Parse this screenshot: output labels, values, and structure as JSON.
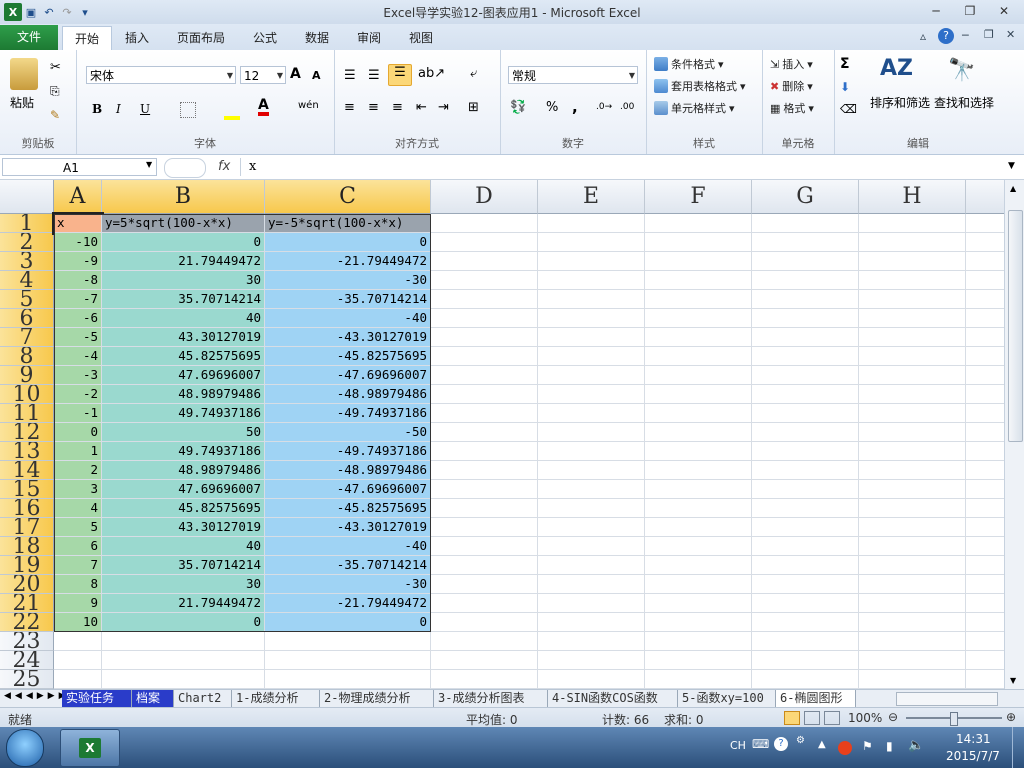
{
  "window": {
    "title": "Excel导学实验12-图表应用1 - Microsoft Excel",
    "minimize": "─",
    "restore": "❐",
    "close": "✕"
  },
  "ribbon_tabs": [
    {
      "label": "文件"
    },
    {
      "label": "开始"
    },
    {
      "label": "插入"
    },
    {
      "label": "页面布局"
    },
    {
      "label": "公式"
    },
    {
      "label": "数据"
    },
    {
      "label": "审阅"
    },
    {
      "label": "视图"
    }
  ],
  "ribbon": {
    "clipboard": {
      "label": "剪贴板",
      "paste": "粘贴"
    },
    "font": {
      "label": "字体",
      "name": "宋体",
      "size": "12",
      "bold": "B",
      "italic": "I",
      "underline": "U",
      "grow": "A",
      "shrink": "A",
      "wen": "wén"
    },
    "align": {
      "label": "对齐方式"
    },
    "number": {
      "label": "数字",
      "format": "常规",
      "percent": "%",
      "comma": ","
    },
    "styles": {
      "label": "样式",
      "cond": "条件格式",
      "table": "套用表格格式",
      "cell": "单元格样式"
    },
    "cells": {
      "label": "单元格",
      "insert": "插入",
      "delete": "删除",
      "format": "格式"
    },
    "editing": {
      "label": "编辑",
      "sum": "Σ",
      "sort": "排序和筛选",
      "find": "查找和选择"
    }
  },
  "formula_bar": {
    "name_box": "A1",
    "fx": "fx",
    "content": "x"
  },
  "columns": [
    "A",
    "B",
    "C",
    "D",
    "E",
    "F",
    "G",
    "H"
  ],
  "row_numbers": [
    "1",
    "2",
    "3",
    "4",
    "5",
    "6",
    "7",
    "8",
    "9",
    "10",
    "11",
    "12",
    "13",
    "14",
    "15",
    "16",
    "17",
    "18",
    "19",
    "20",
    "21",
    "22",
    "23",
    "24",
    "25"
  ],
  "table": {
    "headers": [
      "x",
      "y=5*sqrt(100-x*x)",
      "y=-5*sqrt(100-x*x)"
    ],
    "rows": [
      [
        "-10",
        "0",
        "0"
      ],
      [
        "-9",
        "21.79449472",
        "-21.79449472"
      ],
      [
        "-8",
        "30",
        "-30"
      ],
      [
        "-7",
        "35.70714214",
        "-35.70714214"
      ],
      [
        "-6",
        "40",
        "-40"
      ],
      [
        "-5",
        "43.30127019",
        "-43.30127019"
      ],
      [
        "-4",
        "45.82575695",
        "-45.82575695"
      ],
      [
        "-3",
        "47.69696007",
        "-47.69696007"
      ],
      [
        "-2",
        "48.98979486",
        "-48.98979486"
      ],
      [
        "-1",
        "49.74937186",
        "-49.74937186"
      ],
      [
        "0",
        "50",
        "-50"
      ],
      [
        "1",
        "49.74937186",
        "-49.74937186"
      ],
      [
        "2",
        "48.98979486",
        "-48.98979486"
      ],
      [
        "3",
        "47.69696007",
        "-47.69696007"
      ],
      [
        "4",
        "45.82575695",
        "-45.82575695"
      ],
      [
        "5",
        "43.30127019",
        "-43.30127019"
      ],
      [
        "6",
        "40",
        "-40"
      ],
      [
        "7",
        "35.70714214",
        "-35.70714214"
      ],
      [
        "8",
        "30",
        "-30"
      ],
      [
        "9",
        "21.79449472",
        "-21.79449472"
      ],
      [
        "10",
        "0",
        "0"
      ]
    ]
  },
  "sheet_tabs": [
    {
      "label": "实验任务"
    },
    {
      "label": "档案"
    },
    {
      "label": "Chart2"
    },
    {
      "label": "1-成绩分析"
    },
    {
      "label": "2-物理成绩分析"
    },
    {
      "label": "3-成绩分析图表"
    },
    {
      "label": "4-SIN函数COS函数"
    },
    {
      "label": "5-函数xy=100"
    },
    {
      "label": "6-椭圆图形"
    }
  ],
  "status": {
    "ready": "就绪",
    "average": "平均值: 0",
    "count": "计数: 66",
    "sum": "求和: 0",
    "zoom": "100%"
  },
  "taskbar": {
    "lang": "CH",
    "time": "14:31",
    "date": "2015/7/7"
  },
  "colors": {
    "header_x": "#f9b38c",
    "header_bc": "#9aa3ad",
    "col_a": "#a6d8a8",
    "col_b": "#9ad9cf",
    "col_c": "#9fd3f4"
  }
}
